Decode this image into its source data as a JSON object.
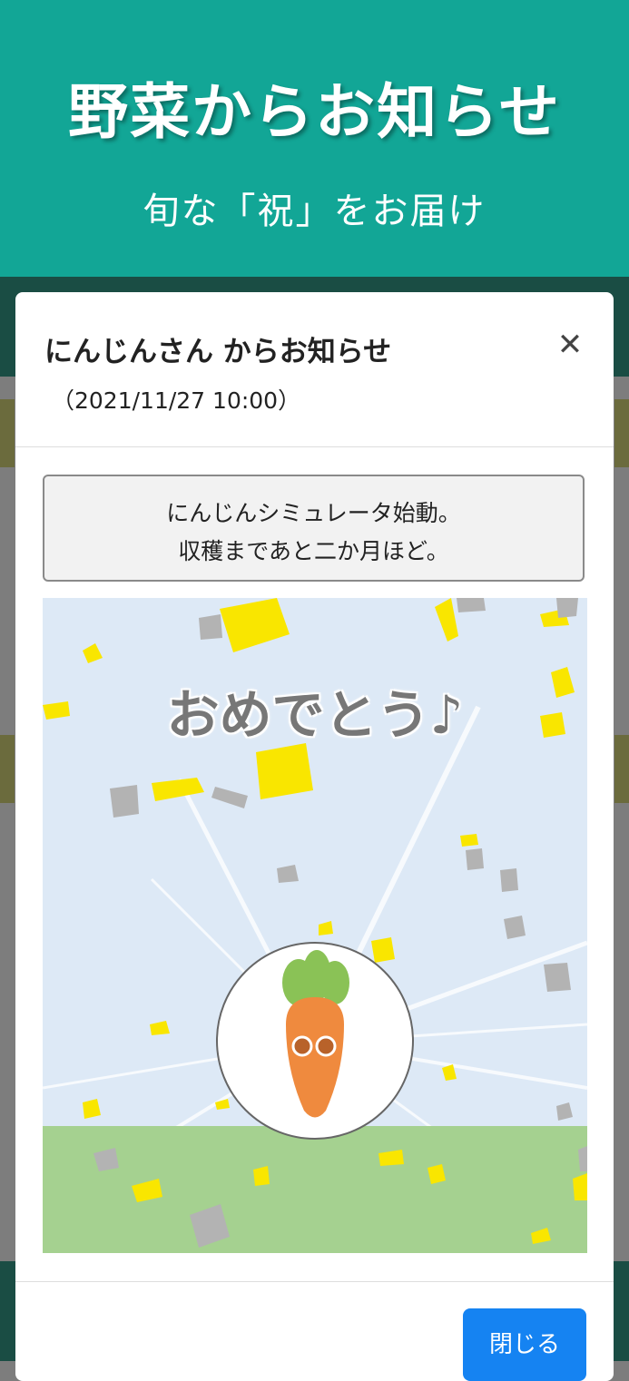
{
  "header": {
    "title": "野菜からお知らせ",
    "subtitle": "旬な「祝」をお届け"
  },
  "modal": {
    "title": "にんじんさん からお知らせ",
    "date": "（2021/11/27 10:00）",
    "close_icon": "close-icon",
    "message_line1": "にんじんシミュレータ始動。",
    "message_line2": "収穫まであと二か月ほど。",
    "scene_text": "おめでとう♪",
    "close_button_label": "閉じる"
  },
  "colors": {
    "header_bg": "#12a696",
    "button_bg": "#1583f2",
    "sky": "#dde9f6",
    "grass": "#a5d190",
    "carrot": "#ef8a3e",
    "leaf": "#8ac256"
  }
}
